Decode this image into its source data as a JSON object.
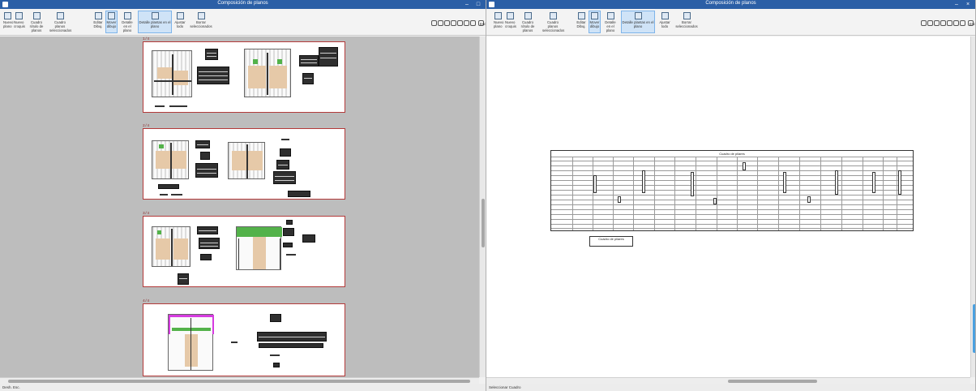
{
  "left_window": {
    "title": "Composición de planos",
    "controls": [
      "–",
      "□"
    ],
    "toolbar": [
      {
        "label": "Nuevo plano",
        "icon": "new-sheet-icon"
      },
      {
        "label": "Nuevo croquis",
        "icon": "draw-icon"
      },
      {
        "label": "Cuadro rótulo de planos",
        "icon": "title-block-icon"
      },
      {
        "label": "Cuadro planos seleccionados",
        "icon": "sheet-list-icon"
      },
      {
        "label": "Editar Dibuj.",
        "icon": "edit-icon"
      },
      {
        "label": "Mover dibujo",
        "icon": "move-icon",
        "active": true
      },
      {
        "label": "Detalle en el plano",
        "icon": "detail-icon"
      },
      {
        "label": "Detalle plantas en el plano",
        "icon": "plan-detail-icon"
      },
      {
        "label": "Ajustar todo",
        "icon": "fit-icon"
      },
      {
        "label": "Borrar seleccionados",
        "icon": "delete-icon"
      }
    ],
    "scale": "Esc.",
    "sheets": [
      {
        "label": "1/4"
      },
      {
        "label": "2/4"
      },
      {
        "label": "3/4"
      },
      {
        "label": "4/4"
      }
    ],
    "status": "Desh. Esc."
  },
  "right_window": {
    "title": "Composición de planos",
    "controls": [
      "–",
      "×"
    ],
    "toolbar": [
      {
        "label": "Nuevo plano",
        "icon": "new-sheet-icon"
      },
      {
        "label": "Nuevo croquis",
        "icon": "draw-icon"
      },
      {
        "label": "Cuadro rótulo de planos",
        "icon": "title-block-icon"
      },
      {
        "label": "Cuadro planos seleccionados",
        "icon": "sheet-list-icon"
      },
      {
        "label": "Editar Dibuj.",
        "icon": "edit-icon"
      },
      {
        "label": "Mover dibujo",
        "icon": "move-icon",
        "active": true
      },
      {
        "label": "Detalle en el plano",
        "icon": "detail-icon"
      },
      {
        "label": "Detalle plantas en el plano",
        "icon": "plan-detail-icon"
      },
      {
        "label": "Ajustar todo",
        "icon": "fit-icon"
      },
      {
        "label": "Borrar seleccionados",
        "icon": "delete-icon"
      }
    ],
    "scale": "Esc.",
    "report_title": "Cuadro de pilares",
    "legend_box": "Cuadro de pilares",
    "status": "Seleccionar     Cuadro"
  }
}
